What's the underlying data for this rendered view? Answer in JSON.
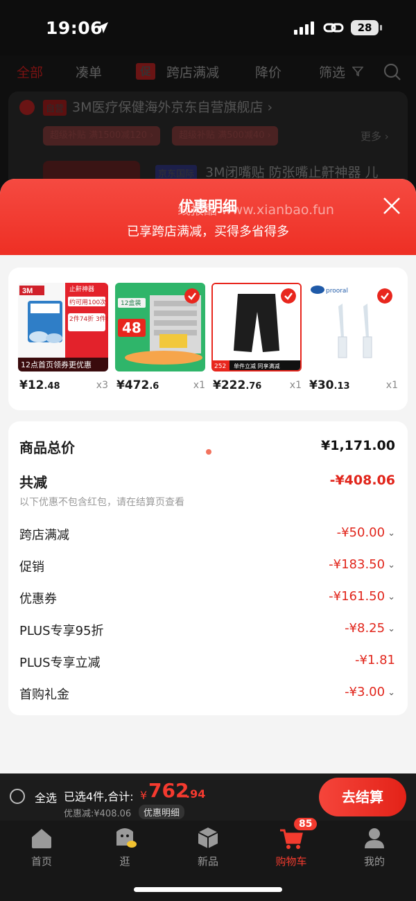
{
  "status_bar": {
    "time": "19:06",
    "battery": "28"
  },
  "cart_tabs": [
    {
      "label": "全部",
      "active": true
    },
    {
      "label": "凑单",
      "active": false
    },
    {
      "label": "跨店满减",
      "active": false
    },
    {
      "label": "降价",
      "active": false
    },
    {
      "label": "筛选",
      "active": false
    }
  ],
  "promo_badge": "促",
  "store": {
    "self_badge": "自营",
    "name": "3M医疗保健海外京东自营旗舰店 ›",
    "coupons": [
      "超级补贴 满1500减120 ›",
      "超级补贴 满500减40 ›"
    ],
    "more": "更多 ›",
    "intl_badge": "京东国际",
    "item_title": "3M闭嘴贴 防张嘴止鼾神器 儿"
  },
  "sheet": {
    "title": "优惠明细",
    "watermark": "线报酷 www.xianbao.fun",
    "subtitle": "已享跨店满减，买得多省得多"
  },
  "products": [
    {
      "price_int": "¥12",
      "price_dec": ".48",
      "qty": "x3",
      "img_caption": "12点首页领券更优惠",
      "img_label": "止鼾神器",
      "img_text2": "约可用100次",
      "img_text3": "2件74折 3件6折"
    },
    {
      "price_int": "¥472",
      "price_dec": ".6",
      "qty": "x1",
      "img_text1": "12盒装",
      "img_text2": "48"
    },
    {
      "price_int": "¥222",
      "price_dec": ".76",
      "qty": "x1",
      "img_text1": "252",
      "img_text2": "单件立减 同享满减"
    },
    {
      "price_int": "¥30",
      "price_dec": ".13",
      "qty": "x1",
      "img_text1": "prooral"
    }
  ],
  "summary": {
    "total_label": "商品总价",
    "total_value": "¥1,171.00",
    "reduce_label": "共减",
    "reduce_value": "-¥408.06",
    "note": "以下优惠不包含红包，请在结算页查看",
    "items": [
      {
        "label": "跨店满减",
        "value": "-¥50.00",
        "chevron": true
      },
      {
        "label": "促销",
        "value": "-¥183.50",
        "chevron": true
      },
      {
        "label": "优惠券",
        "value": "-¥161.50",
        "chevron": true
      },
      {
        "label": "PLUS专享95折",
        "value": "-¥8.25",
        "chevron": true
      },
      {
        "label": "PLUS专享立减",
        "value": "-¥1.81",
        "chevron": false
      },
      {
        "label": "首购礼金",
        "value": "-¥3.00",
        "chevron": true
      }
    ]
  },
  "checkout": {
    "select_all": "全选",
    "selected": "已选4件,合计:",
    "total_symbol": "¥",
    "total_int": "762",
    "total_dec": ".94",
    "discount": "优惠减:¥408.06",
    "detail_chip": "优惠明细",
    "button": "去结算"
  },
  "tabbar": [
    {
      "label": "首页",
      "icon": "home-icon"
    },
    {
      "label": "逛",
      "icon": "explore-icon"
    },
    {
      "label": "新品",
      "icon": "cube-icon"
    },
    {
      "label": "购物车",
      "icon": "cart-icon",
      "active": true,
      "badge": "85"
    },
    {
      "label": "我的",
      "icon": "profile-icon"
    }
  ],
  "colors": {
    "accent": "#e1251b",
    "header_red": "#f23d33"
  }
}
